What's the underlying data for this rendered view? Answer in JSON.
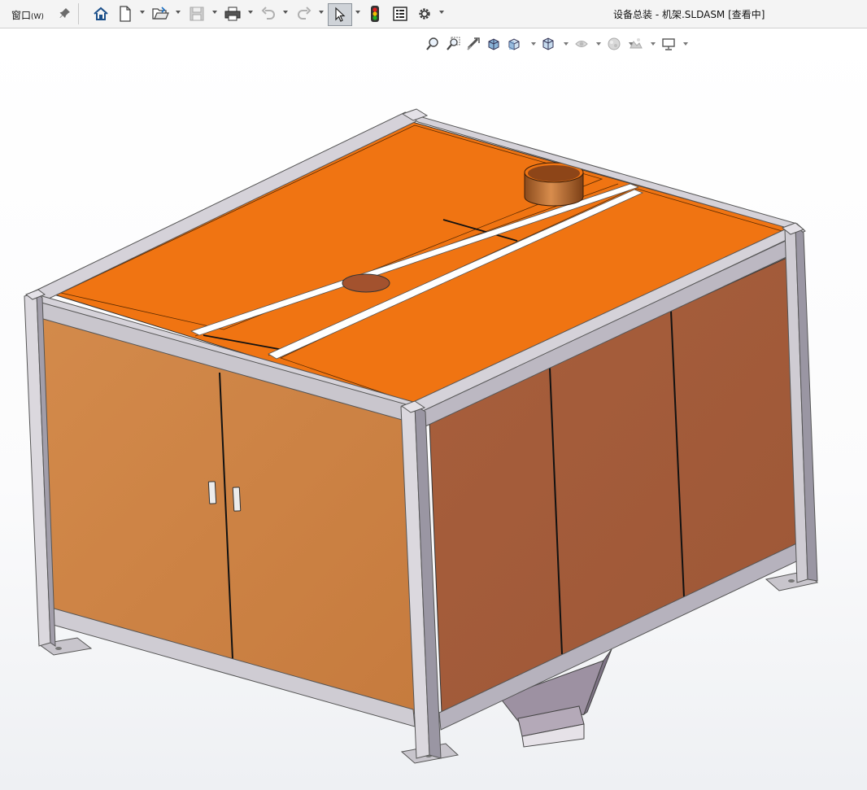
{
  "menu": {
    "window_label": "窗口",
    "window_accel": "(W)"
  },
  "document": {
    "title": "设备总装 - 机架.SLDASM [查看中]"
  },
  "toolbar": {
    "icons": [
      "home-icon",
      "new-document-icon",
      "open-folder-icon",
      "save-icon",
      "print-icon",
      "undo-icon",
      "redo-icon",
      "select-cursor-icon",
      "rebuild-traffic-light-icon",
      "file-properties-icon",
      "options-gear-icon"
    ]
  },
  "heads_up_view_toolbar": {
    "icons": [
      "zoom-to-fit-icon",
      "zoom-to-area-icon",
      "previous-view-icon",
      "section-view-icon",
      "view-orientation-icon",
      "display-style-icon",
      "hide-show-items-icon",
      "edit-appearance-icon",
      "apply-scene-icon",
      "view-settings-icon"
    ]
  },
  "colors": {
    "top_panel": "#f07412",
    "front_panel": "#cd8446",
    "side_panel": "#a35d3b",
    "frame": "#b8b5bf",
    "frame_dark": "#8a8691",
    "hopper": "#9b8f9f",
    "duct": "#b86a2e"
  }
}
